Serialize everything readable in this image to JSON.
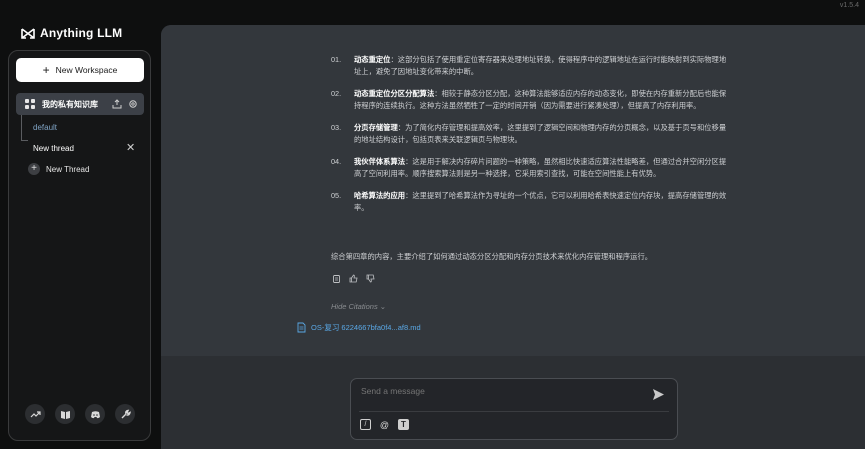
{
  "app": {
    "name": "Anything LLM",
    "version": "v1.5.4"
  },
  "sidebar": {
    "new_workspace_label": "New Workspace",
    "workspace_name": "我的私有知识库",
    "threads": [
      {
        "label": "default"
      },
      {
        "label": "New thread"
      }
    ],
    "new_thread_label": "New Thread",
    "footer_icons": [
      "community-hub-icon",
      "docs-book-icon",
      "discord-icon",
      "wrench-settings-icon"
    ]
  },
  "chat": {
    "items": [
      {
        "num": "01.",
        "title": "动态重定位",
        "text": "：这部分包括了使用重定位寄存器来处理地址转换，使得程序中的逻辑地址在运行时能映射到实际物理地址上，避免了因地址变化带来的中断。"
      },
      {
        "num": "02.",
        "title": "动态重定位分区分配算法",
        "text": "：相较于静态分区分配，这种算法能够适应内存的动态变化，即使在内存重新分配后也能保持程序的连续执行。这种方法虽然牺牲了一定的时间开销（因为需要进行紧凑处理），但提高了内存利用率。"
      },
      {
        "num": "03.",
        "title": "分页存储管理",
        "text": "：为了简化内存管理和提高效率，这里提到了逻辑空间和物理内存的分页概念，以及基于页号和位移量的地址结构设计，包括页表来关联逻辑页与物理块。"
      },
      {
        "num": "04.",
        "title": "我伙伴体系算法",
        "text": "：这是用于解决内存碎片问题的一种策略，虽然相比快速适应算法性能略差，但通过合并空闲分区提高了空间利用率。顺序搜索算法则是另一种选择，它采用索引查找，可能在空间性能上有优势。"
      },
      {
        "num": "05.",
        "title": "哈希算法的应用",
        "text": "：这里提到了哈希算法作为寻址的一个优点，它可以利用哈希表快速定位内存块，提高存储管理的效率。"
      }
    ],
    "summary": "综合第四章的内容，主要介绍了如何通过动态分区分配和内存分页技术来优化内存管理和程序运行。",
    "hide_citations_label": "Hide Citations",
    "citation_file": "OS-复习 6224667bfa0f4...af8.md",
    "input_placeholder": "Send a message"
  },
  "colors": {
    "accent_link": "#5aa8e6",
    "main_bg": "#33373c",
    "sidebar_bg": "#151617"
  }
}
